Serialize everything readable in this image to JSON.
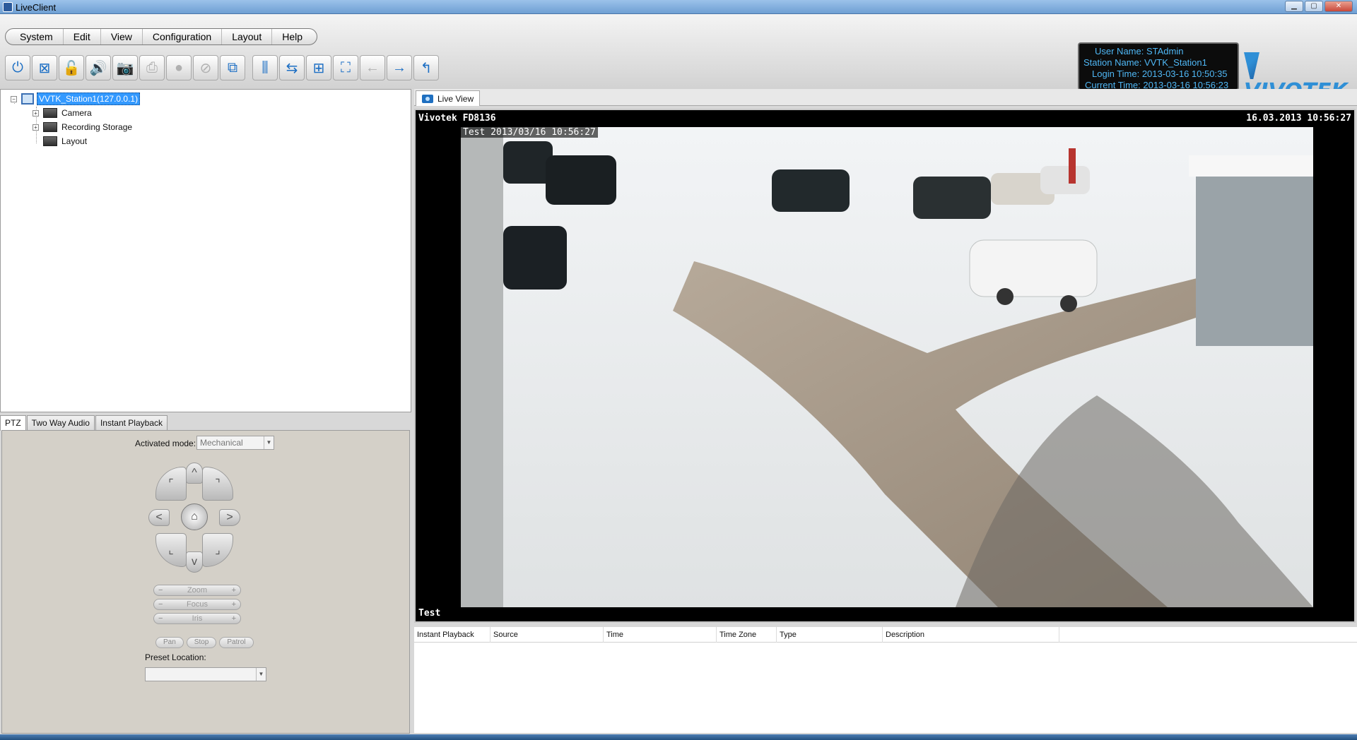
{
  "window": {
    "title": "LiveClient"
  },
  "menu": [
    "System",
    "Edit",
    "View",
    "Configuration",
    "Layout",
    "Help"
  ],
  "toolbar": {
    "buttons": [
      {
        "icon": "power-icon",
        "enabled": true
      },
      {
        "icon": "network-disconnect-icon",
        "enabled": true
      },
      {
        "icon": "lock-icon",
        "enabled": true
      },
      {
        "icon": "speaker-icon",
        "enabled": false
      },
      {
        "icon": "snapshot-camera-icon",
        "enabled": false
      },
      {
        "icon": "print-icon",
        "enabled": false
      },
      {
        "icon": "record-icon",
        "enabled": false
      },
      {
        "icon": "stop-icon",
        "enabled": false
      },
      {
        "icon": "switch-view-icon",
        "enabled": true
      },
      {
        "icon": "split-view-icon",
        "enabled": true
      },
      {
        "icon": "sequence-icon",
        "enabled": true
      },
      {
        "icon": "grid-layout-icon",
        "enabled": true
      },
      {
        "icon": "fullscreen-icon",
        "enabled": true
      },
      {
        "icon": "back-arrow-icon",
        "enabled": false
      },
      {
        "icon": "forward-arrow-icon",
        "enabled": true
      },
      {
        "icon": "return-icon",
        "enabled": true
      }
    ]
  },
  "session": {
    "user": "User Name: STAdmin",
    "station": "Station Name: VVTK_Station1",
    "login": "Login Time: 2013-03-16 10:50:35",
    "current": "Current Time: 2013-03-16 10:56:23"
  },
  "brand": {
    "name": "VIVOTEK",
    "color": "#2f8fd6"
  },
  "tree": {
    "root": "VVTK_Station1(127.0.0.1)",
    "children": [
      "Camera",
      "Recording Storage",
      "Layout"
    ]
  },
  "ptz": {
    "tabs": [
      "PTZ",
      "Two Way Audio",
      "Instant Playback"
    ],
    "activated_mode_label": "Activated mode:",
    "activated_mode_value": "Mechanical",
    "sliders": [
      {
        "minus": "−",
        "label": "Zoom",
        "plus": "+"
      },
      {
        "minus": "−",
        "label": "Focus",
        "plus": "+"
      },
      {
        "minus": "−",
        "label": "Iris",
        "plus": "+"
      }
    ],
    "buttons": [
      "Pan",
      "Stop",
      "Patrol"
    ],
    "preset_label": "Preset Location:",
    "preset_value": ""
  },
  "live": {
    "tab_label": "Live View",
    "camera_name": "Vivotek FD8136",
    "timestamp": "16.03.2013 10:56:27",
    "osd_text": "Test 2013/03/16 10:56:27",
    "bottom_label": "Test"
  },
  "playback": {
    "columns": [
      "Instant Playback",
      "Source",
      "Time",
      "Time Zone",
      "Type",
      "Description"
    ]
  }
}
